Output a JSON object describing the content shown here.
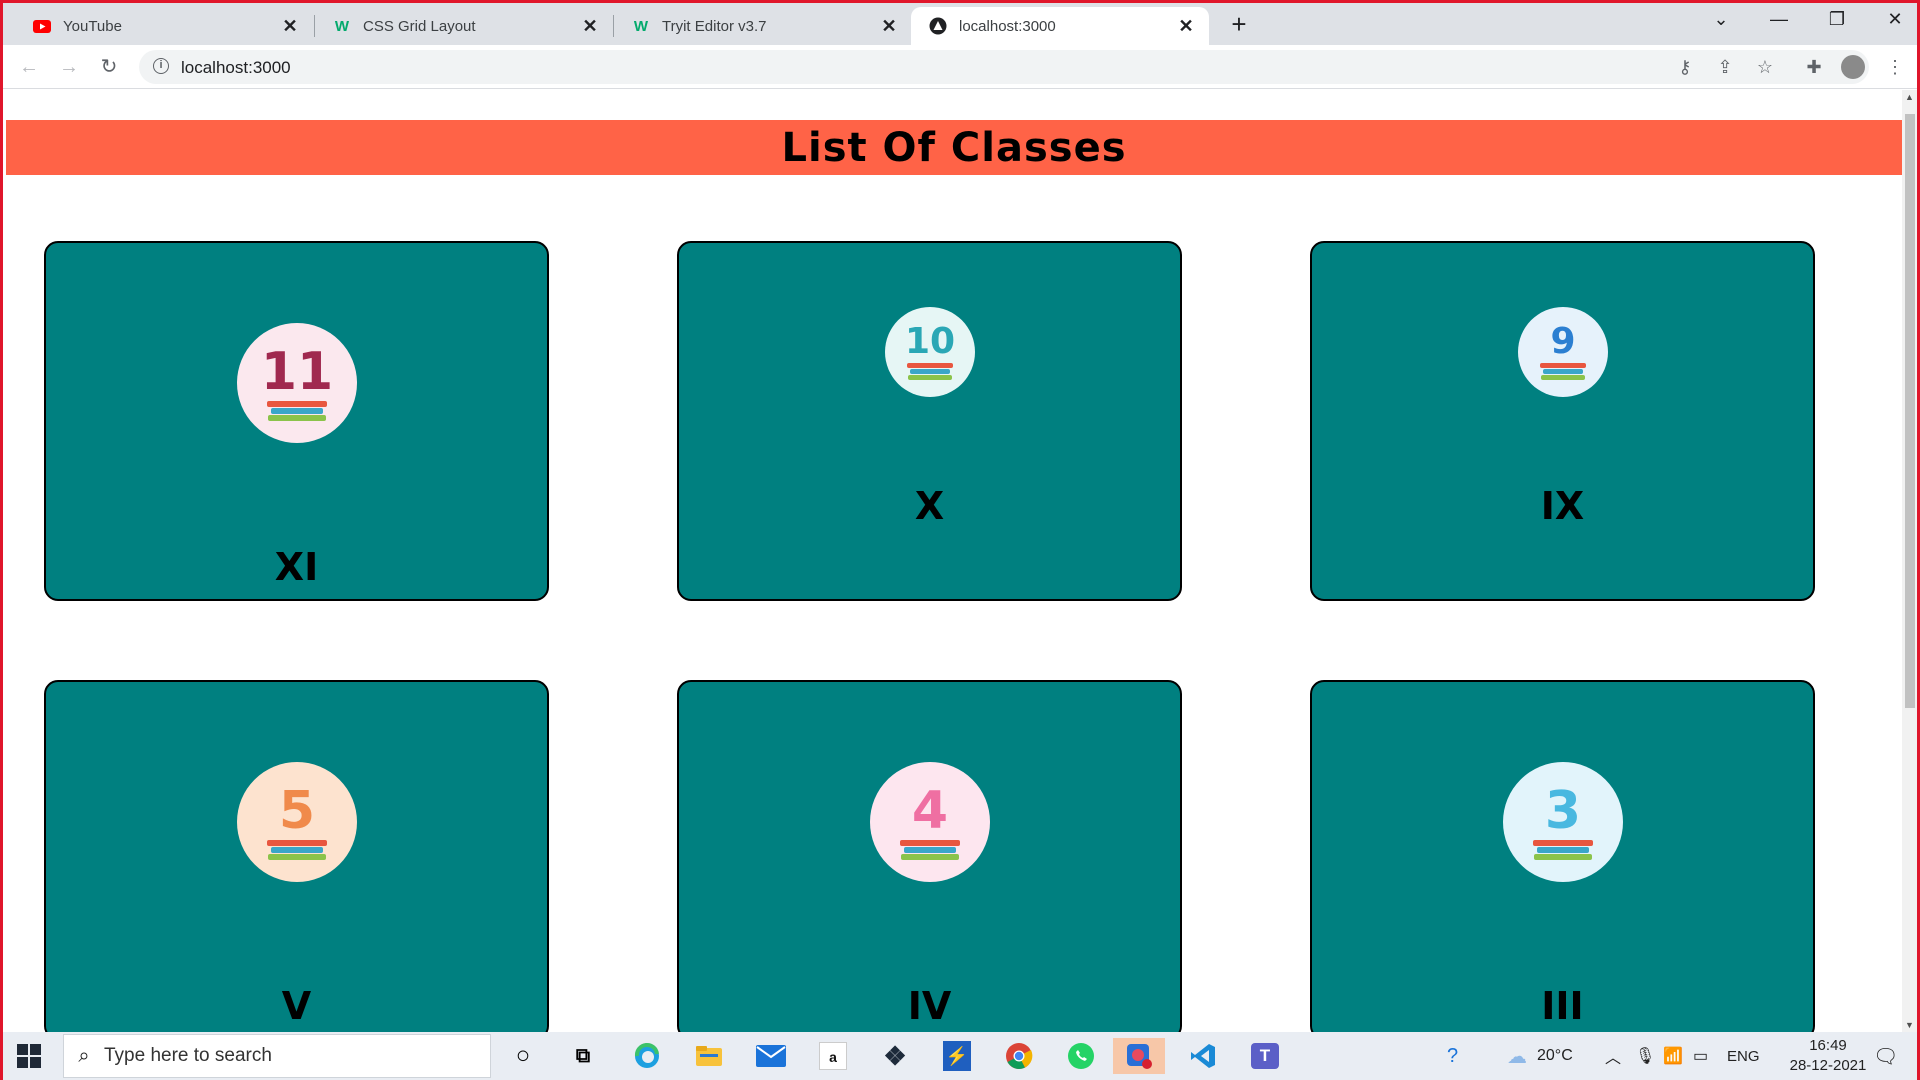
{
  "browser": {
    "tabs": [
      {
        "title": "YouTube",
        "icon": "youtube-icon",
        "active": false
      },
      {
        "title": "CSS Grid Layout",
        "icon": "w3schools-icon",
        "active": false
      },
      {
        "title": "Tryit Editor v3.7",
        "icon": "w3schools-icon",
        "active": false
      },
      {
        "title": "localhost:3000",
        "icon": "react-app-icon",
        "active": true
      }
    ],
    "url": "localhost:3000"
  },
  "page": {
    "title": "List Of Classes",
    "header_color": "#ff6347",
    "card_color": "#008080",
    "cards": [
      {
        "number": "11",
        "label": "XI",
        "number_color": "#a0294f",
        "bg": "#fbe8ee"
      },
      {
        "number": "10",
        "label": "X",
        "number_color": "#2aa7b5",
        "bg": "#e6f6f5"
      },
      {
        "number": "9",
        "label": "IX",
        "number_color": "#2b7fd1",
        "bg": "#e6f2fb"
      },
      {
        "number": "5",
        "label": "V",
        "number_color": "#f08a4b",
        "bg": "#fde3cf"
      },
      {
        "number": "4",
        "label": "IV",
        "number_color": "#ef6fa2",
        "bg": "#fde6ef"
      },
      {
        "number": "3",
        "label": "III",
        "number_color": "#49b8e0",
        "bg": "#e2f4fb"
      }
    ]
  },
  "taskbar": {
    "search_placeholder": "Type here to search",
    "weather": "20°C",
    "language": "ENG",
    "time": "16:49",
    "date": "28-12-2021",
    "amazon_label": "a"
  }
}
